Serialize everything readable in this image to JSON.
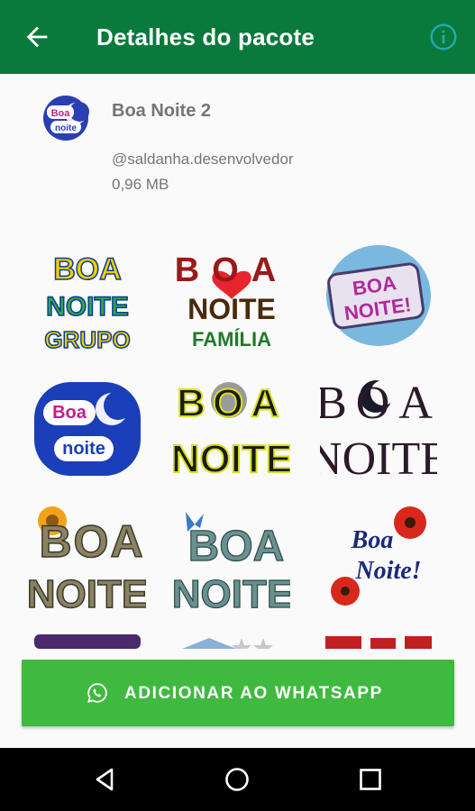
{
  "app_bar": {
    "title": "Detalhes do pacote",
    "back_icon": "arrow-back-icon",
    "info_icon": "info-outline-icon"
  },
  "pack": {
    "icon_text": [
      "Boa",
      "noite"
    ],
    "name": "Boa Noite 2",
    "author": "@saldanha.desenvolvedor",
    "size": "0,96 MB"
  },
  "stickers": [
    {
      "id": "s1",
      "lines": [
        "BOA",
        "NOITE",
        "GRUPO"
      ]
    },
    {
      "id": "s2",
      "lines": [
        "BOA",
        "NOITE",
        "FAMÍLIA"
      ]
    },
    {
      "id": "s3",
      "lines": [
        "BOA",
        "NOITE!"
      ]
    },
    {
      "id": "s4",
      "lines": [
        "Boa",
        "noite"
      ]
    },
    {
      "id": "s5",
      "lines": [
        "BOA",
        "NOITE"
      ]
    },
    {
      "id": "s6",
      "lines": [
        "BOA",
        "NOITE"
      ]
    },
    {
      "id": "s7",
      "lines": [
        "BOA",
        "NOITE"
      ]
    },
    {
      "id": "s8",
      "lines": [
        "BOA",
        "NOITE"
      ]
    },
    {
      "id": "s9",
      "lines": [
        "Boa",
        "Noite!"
      ]
    }
  ],
  "add_button": {
    "label": "ADICIONAR AO WHATSAPP",
    "icon": "whatsapp-icon"
  },
  "nav_bar": {
    "back_icon": "nav-back-triangle-icon",
    "home_icon": "nav-home-circle-icon",
    "recents_icon": "nav-recents-square-icon"
  },
  "colors": {
    "app_bar": "#0a7a3c",
    "add_button": "#3fba3f",
    "secondary_text": "#757575"
  }
}
